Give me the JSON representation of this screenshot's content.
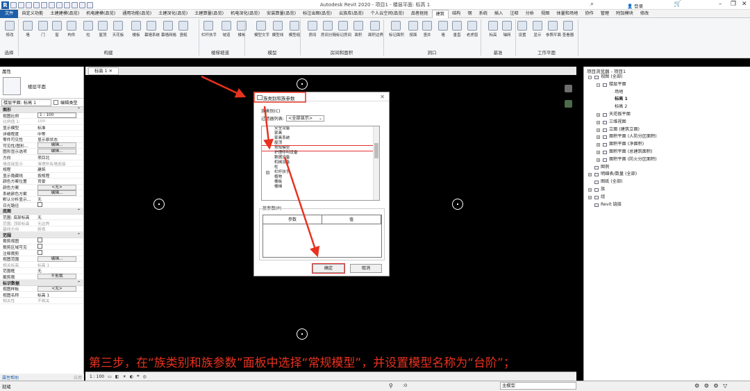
{
  "window": {
    "title": "Autodesk Revit 2020 - 项目1 - 楼层平面: 标高 1",
    "signin": "登录"
  },
  "menu": {
    "file": "文件",
    "tabs": [
      "自定义功能",
      "土建建模(品览)",
      "机电建模(品览)",
      "通用功能(品览)",
      "土建深化(品览)",
      "土建算量(品览)",
      "机电深化(品览)",
      "安装算量(品览)",
      "标注出图(品览)",
      "云族库(品览)",
      "个人云空间(品览)",
      "品者抠抠",
      "建筑",
      "结构",
      "钢",
      "系统",
      "插入",
      "注释",
      "分析",
      "视图",
      "体量和场地",
      "协作",
      "管理",
      "附加模块",
      "修改"
    ],
    "active": "建筑"
  },
  "ribbon": {
    "buttons": [
      "修改",
      "墙",
      "门",
      "窗",
      "构件",
      "柱",
      "屋顶",
      "天花板",
      "楼板",
      "幕墙系统",
      "幕墙网格",
      "竖梃",
      "栏杆扶手",
      "坡道",
      "楼梯",
      "模型文字",
      "模型线",
      "模型组",
      "房间",
      "房间分隔",
      "标记房间",
      "面积",
      "面积边界",
      "标记面积",
      "按面",
      "竖井",
      "墙",
      "垂直",
      "老虎窗",
      "标高",
      "轴网",
      "设置",
      "显示",
      "参照平面",
      "查看器"
    ],
    "groups": [
      "选择",
      "构建",
      "楼梯坡道",
      "模型",
      "房间和面积",
      "洞口",
      "基准",
      "工作平面"
    ]
  },
  "properties": {
    "header": "属性",
    "type_name": "楼层平面",
    "instance_label": "楼层平面: 标高 1",
    "edit_type": "编辑类型",
    "sections": [
      {
        "name": "图形",
        "rows": [
          {
            "k": "视图比例",
            "v": "1 : 100",
            "kind": "input"
          },
          {
            "k": "比例值 1:",
            "v": "100",
            "kind": "dim"
          },
          {
            "k": "显示模型",
            "v": "标准"
          },
          {
            "k": "详细程度",
            "v": "中等"
          },
          {
            "k": "零件可见性",
            "v": "显示原状态"
          },
          {
            "k": "可见性/图形...",
            "v": "编辑...",
            "kind": "btn"
          },
          {
            "k": "图形显示选项",
            "v": "编辑...",
            "kind": "btn"
          },
          {
            "k": "方向",
            "v": "项目北"
          },
          {
            "k": "墙连接显示",
            "v": "清理所有墙连接",
            "kind": "dim"
          },
          {
            "k": "规程",
            "v": "建筑"
          },
          {
            "k": "显示隐藏线",
            "v": "按规程"
          },
          {
            "k": "颜色方案位置",
            "v": "背景"
          },
          {
            "k": "颜色方案",
            "v": "<无>",
            "kind": "btn"
          },
          {
            "k": "系统颜色方案",
            "v": "编辑...",
            "kind": "btn"
          },
          {
            "k": "默认分析显示...",
            "v": "无"
          },
          {
            "k": "日光路径",
            "v": "",
            "kind": "chk"
          }
        ]
      },
      {
        "name": "底图",
        "rows": [
          {
            "k": "范围: 底部标高",
            "v": "无"
          },
          {
            "k": "范围: 顶部标高",
            "v": "无边界",
            "kind": "dim"
          },
          {
            "k": "基线方向",
            "v": "俯视",
            "kind": "dim"
          }
        ]
      },
      {
        "name": "范围",
        "rows": [
          {
            "k": "裁剪视图",
            "v": "",
            "kind": "chk"
          },
          {
            "k": "裁剪区域可见",
            "v": "",
            "kind": "chk"
          },
          {
            "k": "注释裁剪",
            "v": "",
            "kind": "chk"
          },
          {
            "k": "视图范围",
            "v": "编辑...",
            "kind": "btn"
          },
          {
            "k": "相关标高",
            "v": "标高 1",
            "kind": "dim"
          },
          {
            "k": "范围框",
            "v": "无"
          },
          {
            "k": "截剪裁",
            "v": "不剪裁",
            "kind": "btn"
          }
        ]
      },
      {
        "name": "标识数据",
        "rows": [
          {
            "k": "视图样板",
            "v": "<无>",
            "kind": "btn"
          },
          {
            "k": "视图名称",
            "v": "标高 1"
          },
          {
            "k": "相关性",
            "v": "不相关",
            "kind": "dim"
          }
        ]
      }
    ],
    "help": "属性帮助",
    "apply": "应用"
  },
  "view": {
    "tab": "标高 1",
    "scale": "1 : 100"
  },
  "dialog": {
    "title": "族类别和族参数",
    "category_label": "族类别(C)",
    "filter_label": "过滤器列表:",
    "filter_value": "<全部显示>",
    "categories": [
      "安全设备",
      "家具",
      "家具系统",
      "屋顶",
      "常规模型",
      "护理呼叫设备",
      "数据设备",
      "机械设备",
      "柱",
      "栏杆扶手",
      "植物",
      "楼板",
      "楼梯"
    ],
    "selected": "常规模型",
    "param_label": "族参数(P)",
    "col_param": "参数",
    "col_value": "值",
    "ok": "确定",
    "cancel": "取消"
  },
  "browser": {
    "header": "项目浏览器 - 项目1",
    "items": [
      {
        "t": "视图 (全部)",
        "lvl": 0,
        "box": "−"
      },
      {
        "t": "楼层平面",
        "lvl": 1,
        "box": "−"
      },
      {
        "t": "场地",
        "lvl": 2
      },
      {
        "t": "标高 1",
        "lvl": 2,
        "bold": true
      },
      {
        "t": "标高 2",
        "lvl": 2
      },
      {
        "t": "天花板平面",
        "lvl": 1,
        "box": "+"
      },
      {
        "t": "三维视图",
        "lvl": 1,
        "box": "+"
      },
      {
        "t": "立面 (建筑立面)",
        "lvl": 1,
        "box": "+"
      },
      {
        "t": "面积平面 (人防分区面积)",
        "lvl": 1,
        "box": "+"
      },
      {
        "t": "面积平面 (净面积)",
        "lvl": 1,
        "box": "+"
      },
      {
        "t": "面积平面 (总建筑面积)",
        "lvl": 1,
        "box": "+"
      },
      {
        "t": "面积平面 (防火分区面积)",
        "lvl": 1,
        "box": "+"
      },
      {
        "t": "图例",
        "lvl": 0
      },
      {
        "t": "明细表/数量 (全部)",
        "lvl": 0,
        "box": "+"
      },
      {
        "t": "图纸 (全部)",
        "lvl": 0
      },
      {
        "t": "族",
        "lvl": 0,
        "box": "+"
      },
      {
        "t": "组",
        "lvl": 0,
        "box": "+"
      },
      {
        "t": "Revit 链接",
        "lvl": 0
      }
    ]
  },
  "status": {
    "text": "就绪",
    "model": "主模型",
    "filter_count": ":0"
  },
  "caption": "第三步，在“族类别和族参数”面板中选择“常规模型”，并设置模型名称为“台阶”；",
  "colors": {
    "accent": "#1f5fa8",
    "annotation": "#e8321f"
  }
}
